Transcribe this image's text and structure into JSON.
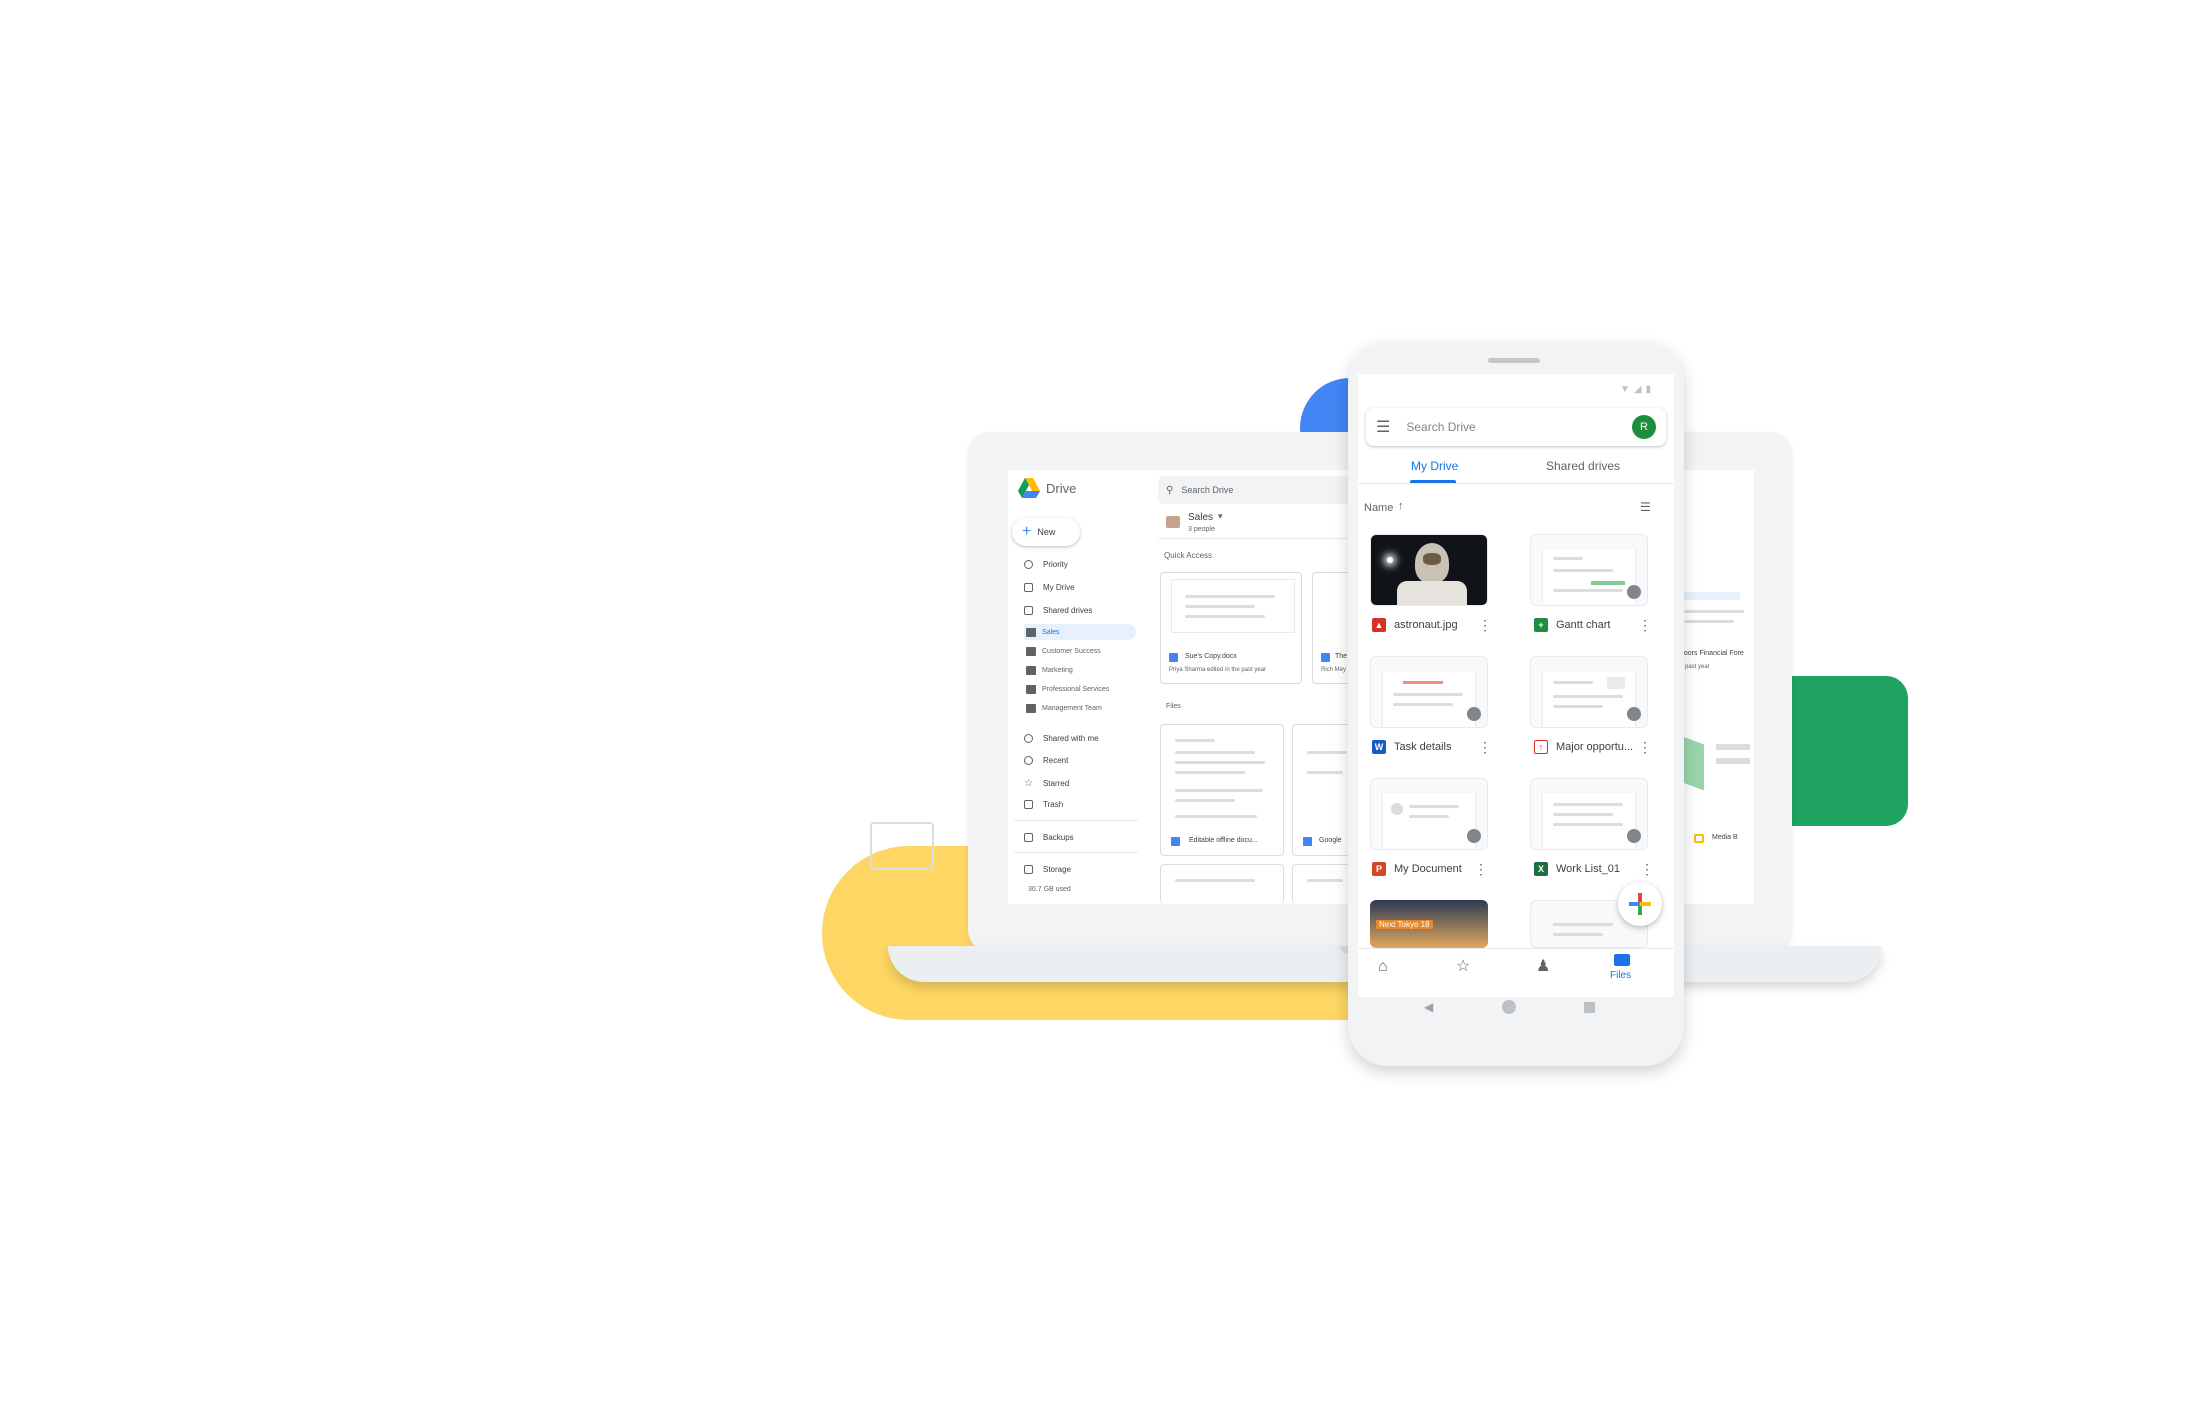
{
  "laptop": {
    "app_name": "Drive",
    "new_label": "New",
    "search_placeholder": "Search Drive",
    "sidebar": {
      "priority": "Priority",
      "my_drive": "My Drive",
      "shared_drives": "Shared drives",
      "drives": [
        "Sales",
        "Customer Success",
        "Marketing",
        "Professional Services",
        "Management Team"
      ],
      "shared_with_me": "Shared with me",
      "recent": "Recent",
      "starred": "Starred",
      "trash": "Trash",
      "backups": "Backups",
      "storage": "Storage",
      "storage_used": "30.7 GB used"
    },
    "header": {
      "drive_name": "Sales",
      "people": "3 people"
    },
    "quick_access_label": "Quick Access",
    "quick_access": [
      {
        "name": "Sue's Copy.docx",
        "meta": "Priya Sharma edited in the past year"
      },
      {
        "name": "The",
        "meta": "Rich Mey"
      }
    ],
    "files_label": "Files",
    "files": [
      "Editable offline docu...",
      "Google"
    ],
    "right_partial": {
      "doc_title": "doors Financial Fore",
      "doc_meta": "n past year",
      "media": "Media B"
    }
  },
  "phone": {
    "search_placeholder": "Search Drive",
    "avatar_letter": "R",
    "tabs": [
      "My Drive",
      "Shared drives"
    ],
    "sort_label": "Name",
    "files": [
      {
        "name": "astronaut.jpg",
        "type": "image"
      },
      {
        "name": "Gantt chart",
        "type": "sheets"
      },
      {
        "name": "Task details",
        "type": "word"
      },
      {
        "name": "Major opportu...",
        "type": "pdf"
      },
      {
        "name": "My Document",
        "type": "powerpoint"
      },
      {
        "name": "Work List_01",
        "type": "excel"
      }
    ],
    "photo_caption": "Next Tokyo 18",
    "nav_active": "Files"
  },
  "colors": {
    "blue": "#1a73e8",
    "green": "#1e8e3e",
    "yellow": "#fdd663",
    "red": "#d93025"
  }
}
